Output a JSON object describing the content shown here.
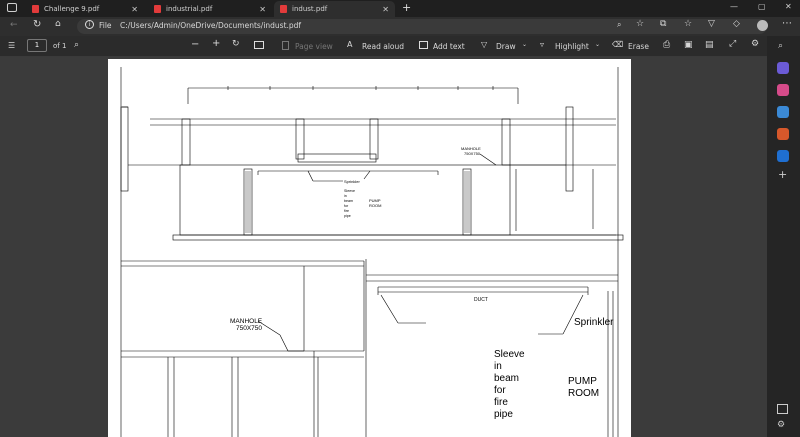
{
  "browser": {
    "tabs": [
      {
        "title": "Challenge 9.pdf",
        "active": false
      },
      {
        "title": "industrial.pdf",
        "active": false
      },
      {
        "title": "indust.pdf",
        "active": true
      }
    ],
    "new_tab_glyph": "+",
    "close_glyph": "✕",
    "window_controls": [
      "—",
      "▢",
      "✕"
    ]
  },
  "address": {
    "scheme_label": "File",
    "url": "C:/Users/Admin/OneDrive/Documents/indust.pdf"
  },
  "pdf_toolbar": {
    "page_number": "1",
    "page_total": "of 1",
    "page_view": "Page view",
    "read_aloud": "Read aloud",
    "add_text": "Add text",
    "draw": "Draw",
    "highlight": "Highlight",
    "erase": "Erase"
  },
  "drawing": {
    "labels_small": {
      "manhole": "MANHOLE",
      "manhole_size": "750X750",
      "sprinkler": "Sprinkler",
      "sleeve": [
        "Sleeve",
        "in",
        "beam",
        "for",
        "fire",
        "pipe"
      ],
      "pump": "PUMP",
      "room": "ROOM"
    },
    "labels_large": {
      "manhole": "MANHOLE",
      "manhole_size": "750X750",
      "duct": "DUCT",
      "sprinkler": "Sprinkler",
      "sleeve": [
        "Sleeve",
        "in",
        "beam",
        "for",
        "fire",
        "pipe"
      ],
      "pump": "PUMP",
      "room": "ROOM"
    }
  },
  "colors": {
    "chrome_dark": "#1f1f1f",
    "toolbar": "#2b2b2b",
    "pdf_icon_red": "#e23b3b",
    "page_bg": "#ffffff"
  }
}
